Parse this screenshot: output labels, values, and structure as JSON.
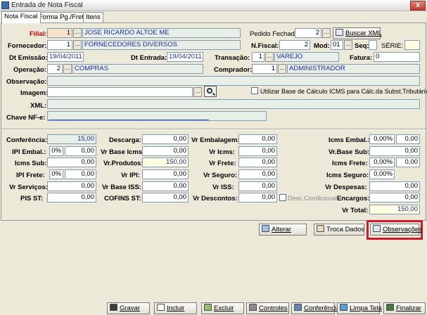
{
  "window": {
    "title": "Entrada de Nota Fiscal",
    "close_glyph": "x"
  },
  "tabs": [
    "Nota Fiscal",
    "Forma Pg./Frete",
    "Itens"
  ],
  "header": {
    "filial_label": "Filial:",
    "filial_code": "1",
    "filial_name": "JOSE RICARDO ALTOE ME",
    "pedido_label": "Pedido Fechado:",
    "pedido_value": "2",
    "buscar_xml_label": "Buscar XML",
    "fornecedor_label": "Fornecedor:",
    "fornecedor_code": "1",
    "fornecedor_name": "FORNECEDORES DIVERSOS",
    "nfiscal_label": "N.Fiscal:",
    "nfiscal_value": "2",
    "mod_label": "Mod:",
    "mod_value": "01",
    "seq_label": "Seq:",
    "serie_label": "SÉRIE:",
    "dt_emissao_label": "Dt Emissão:",
    "dt_emissao_value": "19/04/2011",
    "dt_entrada_label": "Dt Entrada:",
    "dt_entrada_value": "19/04/2011",
    "transacao_label": "Transação:",
    "transacao_code": "1",
    "transacao_name": "VAREJO",
    "fatura_label": "Fatura:",
    "fatura_value": "0",
    "operacao_label": "Operação:",
    "operacao_code": "2",
    "operacao_name": "COMPRAS",
    "comprador_label": "Comprador:",
    "comprador_code": "1",
    "comprador_name": "ADMINISTRADOR",
    "observacao_label": "Observação:",
    "imagem_label": "Imagem:",
    "icms_check_label": "Utilizar Base de Cálculo ICMS para Cálc.da Subst.Tributária",
    "xml_label": "XML:",
    "chave_label": "Chave NF-e:"
  },
  "totals": {
    "conferencia_label": "Conferência:",
    "conferencia_value": "15,00",
    "descarga_label": "Descarga:",
    "descarga_value": "0,00",
    "vr_embalagem_label": "Vr Embalagem:",
    "vr_embalagem_value": "0,00",
    "icms_embal_label": "Icms Embal.:",
    "icms_embal_pct": "0,00%",
    "icms_embal_value": "0,00",
    "ipi_embal_label": "IPI Embal.:",
    "ipi_embal_pct": "0%",
    "ipi_embal_value": "0,00",
    "vr_base_icms_label": "Vr Base Icms:",
    "vr_base_icms_value": "0,00",
    "vr_icms_label": "Vr Icms:",
    "vr_icms_value": "0,00",
    "vr_base_sub_label": "Vr.Base Sub:",
    "vr_base_sub_value": "0,00",
    "icms_sub_label": "Icms Sub:",
    "icms_sub_value": "0,00",
    "vr_produtos_label": "Vr.Produtos:",
    "vr_produtos_value": "150,00",
    "vr_frete_label": "Vr Frete:",
    "vr_frete_value": "0,00",
    "icms_frete_label": "Icms Frete:",
    "icms_frete_pct": "0,00%",
    "icms_frete_value": "0,00",
    "ipi_frete_label": "IPI Frete:",
    "ipi_frete_pct": "0%",
    "ipi_frete_value": "0,00",
    "vr_ipi_label": "Vr IPI:",
    "vr_ipi_value": "0,00",
    "vr_seguro_label": "Vr Seguro:",
    "vr_seguro_value": "0,00",
    "icms_seguro_label": "Icms Seguro:",
    "icms_seguro_pct": "0,00%",
    "vr_servicos_label": "Vr Serviços:",
    "vr_servicos_value": "0,00",
    "vr_base_iss_label": "Vr Base ISS:",
    "vr_base_iss_value": "0,00",
    "vr_iss_label": "Vr ISS:",
    "vr_iss_value": "0,00",
    "vr_despesas_label": "Vr Despesas:",
    "vr_despesas_value": "0,00",
    "pis_st_label": "PIS ST:",
    "pis_st_value": "0,00",
    "cofins_st_label": "COFINS ST:",
    "cofins_st_value": "0,00",
    "vr_descontos_label": "Vr Descontos:",
    "vr_descontos_value": "0,00",
    "desc_condicional_label": "Desc.Condicional",
    "encargos_label": "Encargos:",
    "encargos_value": "0,00",
    "vr_total_label": "Vr Total:",
    "vr_total_value": "150,00"
  },
  "actions": {
    "alterar": "Alterar",
    "troca_dados": "Troca Dados",
    "observacoes": "Observações"
  },
  "toolbar": {
    "gravar": "Gravar",
    "incluir": "Incluir",
    "excluir": "Excluir",
    "controles": "Controles",
    "conferencia": "Conferência",
    "limpa_tela": "Limpa Tela",
    "finalizar": "Finalizar"
  },
  "colors": {
    "highlight": "#d0182a",
    "field_text": "#1d2aa3",
    "readonly_bg": "#e8efe6"
  }
}
